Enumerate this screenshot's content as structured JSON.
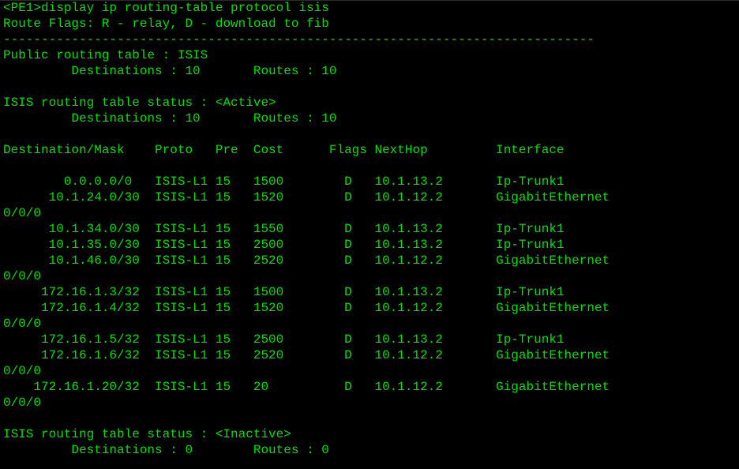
{
  "terminal": {
    "text_color": "#00e000",
    "background": "#000000",
    "lines": [
      "<PE1>display ip routing-table protocol isis",
      "Route Flags: R - relay, D - download to fib",
      "------------------------------------------------------------------------------",
      "Public routing table : ISIS",
      "         Destinations : 10       Routes : 10",
      "",
      "ISIS routing table status : <Active>",
      "         Destinations : 10       Routes : 10",
      "",
      "Destination/Mask    Proto   Pre  Cost      Flags NextHop         Interface",
      "",
      "        0.0.0.0/0   ISIS-L1 15   1500        D   10.1.13.2       Ip-Trunk1",
      "      10.1.24.0/30  ISIS-L1 15   1520        D   10.1.12.2       GigabitEthernet",
      "0/0/0",
      "      10.1.34.0/30  ISIS-L1 15   1550        D   10.1.13.2       Ip-Trunk1",
      "      10.1.35.0/30  ISIS-L1 15   2500        D   10.1.13.2       Ip-Trunk1",
      "      10.1.46.0/30  ISIS-L1 15   2520        D   10.1.12.2       GigabitEthernet",
      "0/0/0",
      "     172.16.1.3/32  ISIS-L1 15   1500        D   10.1.13.2       Ip-Trunk1",
      "     172.16.1.4/32  ISIS-L1 15   1520        D   10.1.12.2       GigabitEthernet",
      "0/0/0",
      "     172.16.1.5/32  ISIS-L1 15   2500        D   10.1.13.2       Ip-Trunk1",
      "     172.16.1.6/32  ISIS-L1 15   2520        D   10.1.12.2       GigabitEthernet",
      "0/0/0",
      "    172.16.1.20/32  ISIS-L1 15   20          D   10.1.12.2       GigabitEthernet",
      "0/0/0",
      "",
      "ISIS routing table status : <Inactive>",
      "         Destinations : 0        Routes : 0"
    ]
  }
}
